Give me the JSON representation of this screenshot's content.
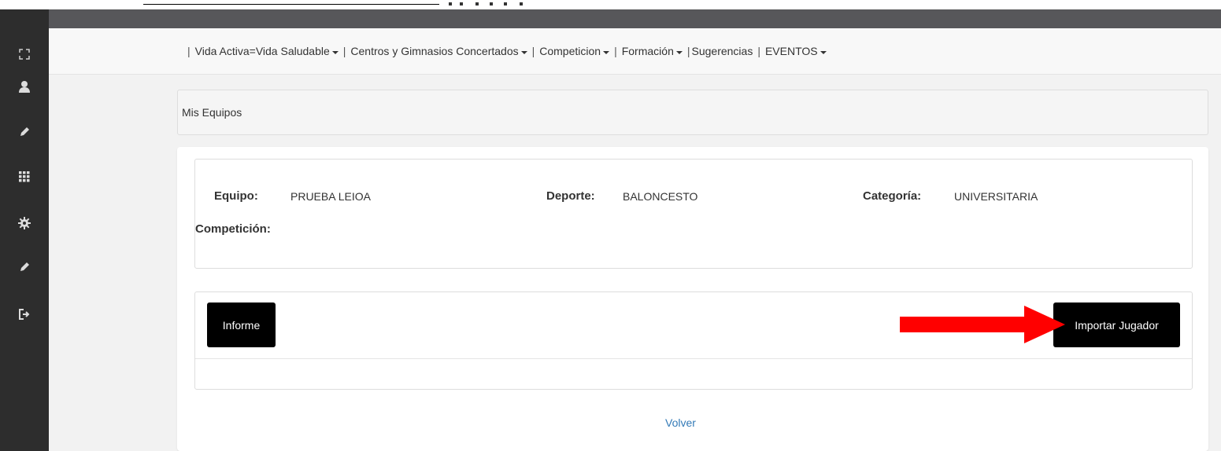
{
  "nav": {
    "items": [
      {
        "label": "Vida Activa=Vida Saludable",
        "dropdown": true
      },
      {
        "label": "Centros y Gimnasios Concertados",
        "dropdown": true
      },
      {
        "label": "Competicion",
        "dropdown": true
      },
      {
        "label": "Formación",
        "dropdown": true
      },
      {
        "label": "Sugerencias",
        "dropdown": false
      },
      {
        "label": "EVENTOS",
        "dropdown": true
      }
    ]
  },
  "panel": {
    "title": "Mis Equipos"
  },
  "team": {
    "equipo_label": "Equipo:",
    "equipo_value": "PRUEBA LEIOA",
    "deporte_label": "Deporte:",
    "deporte_value": "BALONCESTO",
    "categoria_label": "Categoría:",
    "categoria_value": "UNIVERSITARIA",
    "competicion_label": "Competición:"
  },
  "buttons": {
    "informe": "Informe",
    "importar": "Importar Jugador"
  },
  "links": {
    "volver": "Volver"
  },
  "sidebar": {
    "icons": [
      "expand-icon",
      "user-icon",
      "pencil-icon",
      "grid-icon",
      "gear-icon",
      "pencil-icon",
      "logout-icon"
    ]
  },
  "colors": {
    "sidebar": "#2d2d2d",
    "topbar": "#57575a",
    "button": "#000000",
    "arrow": "#ff0000",
    "link": "#337ab7"
  }
}
